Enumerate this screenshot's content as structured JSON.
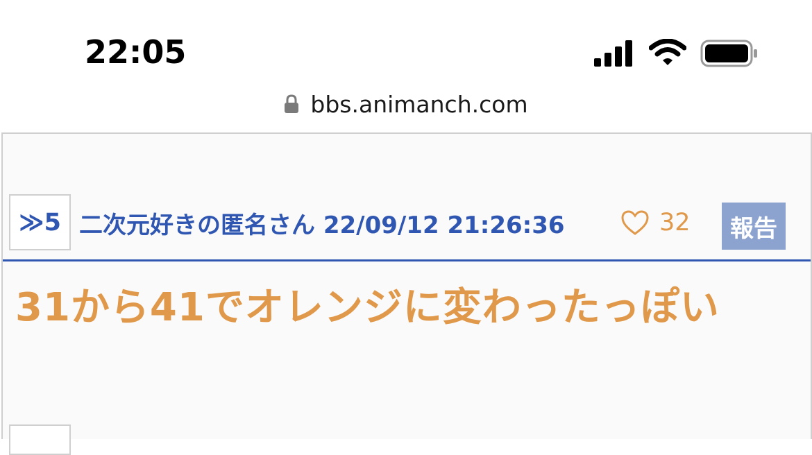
{
  "status_bar": {
    "time": "22:05",
    "icons": [
      "cellular-signal-icon",
      "wifi-icon",
      "battery-icon"
    ]
  },
  "address_bar": {
    "lock_icon": "lock-icon",
    "url": "bbs.animanch.com"
  },
  "post": {
    "reply_anchor": "≫5",
    "author_and_date": "二次元好きの匿名さん 22/09/12 21:26:36",
    "like_icon": "heart-icon",
    "like_count": "32",
    "report_label": "報告",
    "body": "31から41でオレンジに変わったっぽい"
  },
  "colors": {
    "accent_blue": "#2f56b0",
    "orange": "#e0994a",
    "report_bg": "#8ca3cf",
    "border_gray": "#cfcfcf",
    "content_bg": "#fafafa"
  }
}
